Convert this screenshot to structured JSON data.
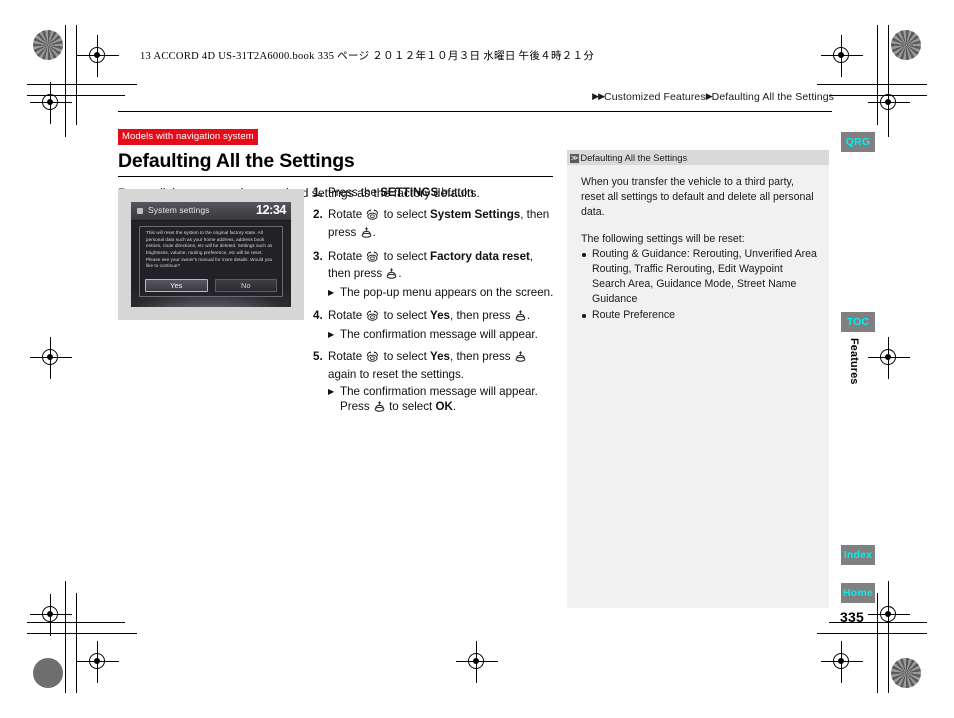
{
  "book_header": "13 ACCORD 4D US-31T2A6000.book   335 ページ   ２０１２年１０月３日   水曜日   午後４時２１分",
  "breadcrumb": {
    "arrows": "▶▶",
    "parent": "Customized Features",
    "separator": "▶",
    "current": "Defaulting All the Settings"
  },
  "main": {
    "badge": "Models with navigation system",
    "title": "Defaulting All the Settings",
    "lede": "Reset all the menu and customized settings as the factory defaults."
  },
  "nav_screen": {
    "title": "System settings",
    "clock": "12:34",
    "dialog_text": "This will reset the system to the original factory state. All personal data such as your home address, address book entries, route directions, etc will be deleted. Settings such as brightness, volume, routing preference, etc will be reset. Please see your owner's manual for more details. Would you like to continue?",
    "button_yes": "Yes",
    "button_no": "No"
  },
  "steps": [
    {
      "num": "1.",
      "parts": [
        {
          "t": "Press the "
        },
        {
          "t": "SETTINGS",
          "b": true
        },
        {
          "t": " button."
        }
      ],
      "subs": []
    },
    {
      "num": "2.",
      "parts": [
        {
          "t": "Rotate "
        },
        {
          "icon": "rotate-knob-icon"
        },
        {
          "t": " to select "
        },
        {
          "t": "System Settings",
          "b": true
        },
        {
          "t": ", then press "
        },
        {
          "icon": "press-knob-icon"
        },
        {
          "t": "."
        }
      ],
      "subs": []
    },
    {
      "num": "3.",
      "parts": [
        {
          "t": "Rotate "
        },
        {
          "icon": "rotate-knob-icon"
        },
        {
          "t": " to select "
        },
        {
          "t": "Factory data reset",
          "b": true
        },
        {
          "t": ", then press "
        },
        {
          "icon": "press-knob-icon"
        },
        {
          "t": "."
        }
      ],
      "subs": [
        {
          "parts": [
            {
              "t": "The pop-up menu appears on the screen."
            }
          ]
        }
      ]
    },
    {
      "num": "4.",
      "parts": [
        {
          "t": "Rotate "
        },
        {
          "icon": "rotate-knob-icon"
        },
        {
          "t": " to select "
        },
        {
          "t": "Yes",
          "b": true
        },
        {
          "t": ", then press "
        },
        {
          "icon": "press-knob-icon"
        },
        {
          "t": "."
        }
      ],
      "subs": [
        {
          "parts": [
            {
              "t": "The confirmation message will appear."
            }
          ]
        }
      ]
    },
    {
      "num": "5.",
      "parts": [
        {
          "t": "Rotate "
        },
        {
          "icon": "rotate-knob-icon"
        },
        {
          "t": " to select "
        },
        {
          "t": "Yes",
          "b": true
        },
        {
          "t": ", then press "
        },
        {
          "icon": "press-knob-icon"
        },
        {
          "t": " again to reset the settings."
        }
      ],
      "subs": [
        {
          "parts": [
            {
              "t": "The confirmation message will appear. Press "
            },
            {
              "icon": "press-knob-icon"
            },
            {
              "t": " to select "
            },
            {
              "t": "OK",
              "b": true
            },
            {
              "t": "."
            }
          ]
        }
      ]
    }
  ],
  "info_panel": {
    "heading": "Defaulting All the Settings",
    "chevron": "≫",
    "paragraph": "When you transfer the vehicle to a third party, reset all settings to default and delete all personal data.",
    "list_intro": "The following settings will be reset:",
    "list": [
      "Routing & Guidance: Rerouting, Unverified Area Routing, Traffic Rerouting, Edit Waypoint Search Area, Guidance Mode, Street Name Guidance",
      "Route Preference"
    ]
  },
  "tabs": [
    {
      "id": "qrg",
      "label": "QRG"
    },
    {
      "id": "toc",
      "label": "TOC"
    },
    {
      "id": "index",
      "label": "Index"
    },
    {
      "id": "home",
      "label": "Home"
    }
  ],
  "side_label": "Features",
  "page_number": "335",
  "colors": {
    "badge_red": "#e50b18",
    "tab_bg": "#808080",
    "tab_text": "#00f0f0",
    "panel_bg": "#f1f1f1",
    "panel_head_bg": "#d9d9d9"
  }
}
